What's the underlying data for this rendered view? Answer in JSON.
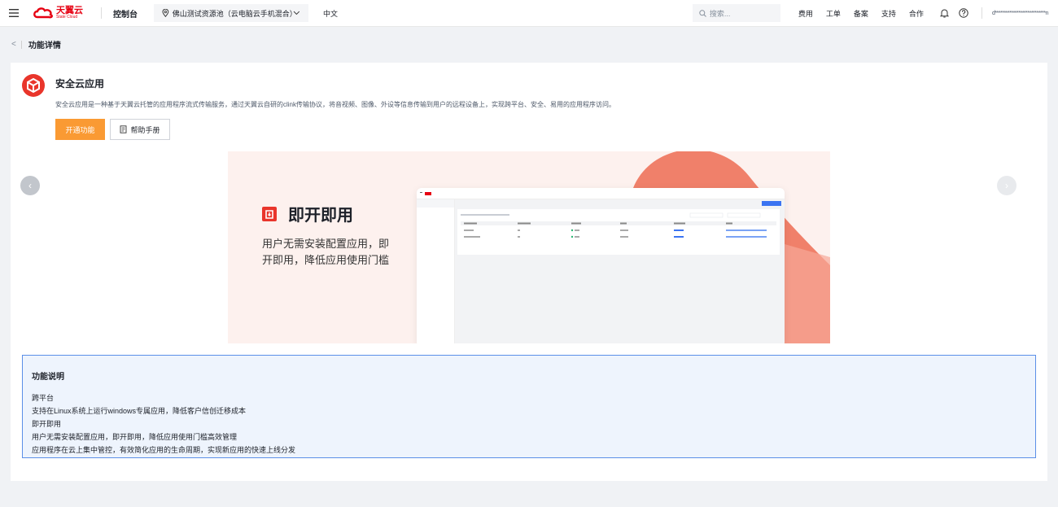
{
  "header": {
    "logo_cn": "天翼云",
    "logo_en": "State Cloud",
    "console": "控制台",
    "region": "佛山测试资源池（云电脑云手机混合）",
    "language": "中文",
    "search_placeholder": "搜索...",
    "nav": [
      "费用",
      "工单",
      "备案",
      "支持",
      "合作"
    ],
    "user": "d****************************n"
  },
  "breadcrumb": {
    "back": "<",
    "title": "功能详情"
  },
  "product": {
    "name": "安全云应用",
    "description": "安全云应用是一种基于天翼云托管的应用程序流式传输服务，通过天翼云自研的clink传输协议，将音视频、图像、外设等信息传输到用户的远程设备上，实现跨平台、安全、易用的应用程序访问。",
    "primary_button": "开通功能",
    "secondary_button": "帮助手册"
  },
  "carousel": {
    "slide_title": "即开即用",
    "slide_desc": "用户无需安装配置应用，即开即用，降低应用使用门槛",
    "prev": "‹",
    "next": "›"
  },
  "feature_desc": {
    "heading": "功能说明",
    "lines": [
      "跨平台",
      "支持在Linux系统上运行windows专属应用，降低客户信创迁移成本",
      "即开即用",
      "用户无需安装配置应用，即开即用，降低应用使用门槛高效管理",
      "应用程序在云上集中管控，有效简化应用的生命周期，实现新应用的快速上线分发"
    ]
  },
  "colors": {
    "accent": "#fa9a33",
    "brand": "#e60012",
    "info_border": "#5b8fe8",
    "info_bg": "#eef4fd"
  }
}
